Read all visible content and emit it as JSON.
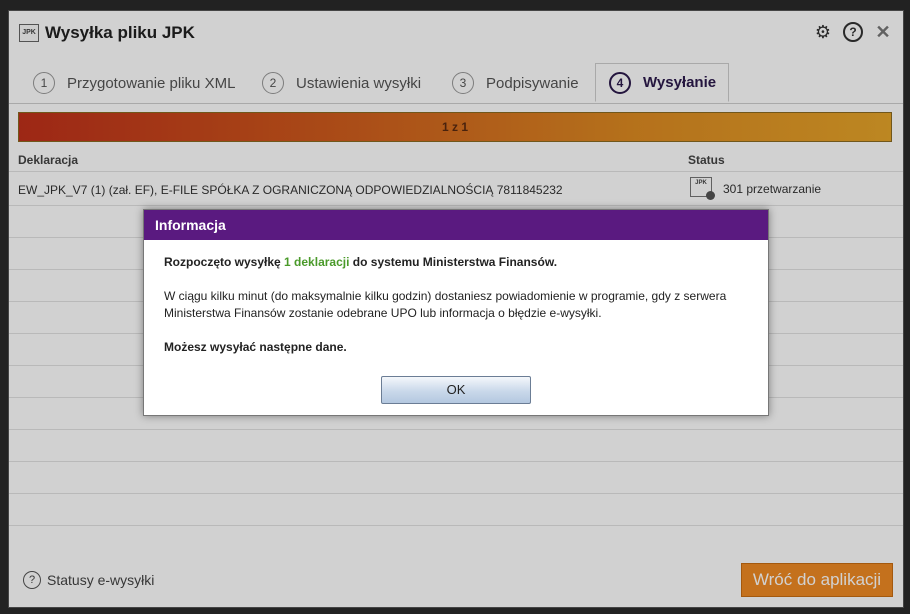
{
  "window": {
    "title": "Wysyłka pliku JPK",
    "logo_text": "JPK",
    "icons": {
      "settings": "gear-icon",
      "help": "help-icon",
      "close": "close-icon"
    }
  },
  "tabs": [
    {
      "num": "1",
      "label": "Przygotowanie pliku XML"
    },
    {
      "num": "2",
      "label": "Ustawienia wysyłki"
    },
    {
      "num": "3",
      "label": "Podpisywanie"
    },
    {
      "num": "4",
      "label": "Wysyłanie"
    }
  ],
  "progress": {
    "text": "1 z 1",
    "fraction": 1.0
  },
  "table": {
    "headers": {
      "declaration": "Deklaracja",
      "status": "Status"
    },
    "rows": [
      {
        "declaration": "EW_JPK_V7 (1) (zał. EF), E-FILE SPÓŁKA Z OGRANICZONĄ ODPOWIEDZIALNOŚCIĄ 7811845232",
        "status_icon_text": "JPK",
        "status": "301 przetwarzanie"
      }
    ]
  },
  "footer": {
    "help_link": "Statusy e-wysyłki",
    "back_button": "Wróć do aplikacji"
  },
  "dialog": {
    "title": "Informacja",
    "line1_pre": "Rozpoczęto wysyłkę ",
    "line1_highlight": "1 deklaracji",
    "line1_post": " do systemu Ministerstwa Finansów.",
    "line2": "W ciągu kilku minut (do maksymalnie kilku godzin) dostaniesz powiadomienie w programie, gdy z serwera Ministerstwa Finansów zostanie odebrane UPO lub informacja o błędzie e-wysyłki.",
    "line3": "Możesz wysyłać następne dane.",
    "ok_button": "OK"
  },
  "colors": {
    "dialog_header": "#5a1a80",
    "highlight": "#4a9a2a",
    "back_button": "#f08a24",
    "active_tab": "#2c1a4c"
  }
}
